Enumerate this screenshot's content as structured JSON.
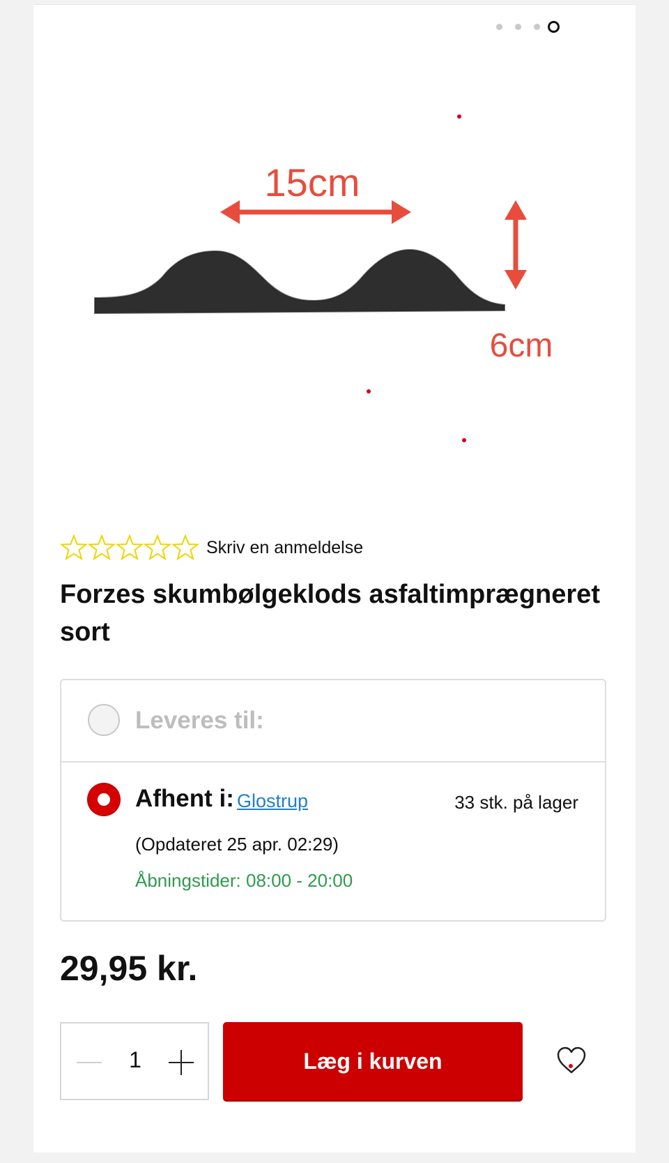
{
  "gallery": {
    "slide_count": 4,
    "active_slide": 4,
    "image": {
      "width_label": "15cm",
      "height_label": "6cm",
      "colors": {
        "foam": "#2e2e2e",
        "annotation": "#e84c3d"
      }
    }
  },
  "rating": {
    "stars_filled": 0,
    "stars_total": 5,
    "review_link": "Skriv en anmeldelse",
    "star_color": "#f0d400"
  },
  "product": {
    "title": "Forzes skumbølgeklods asfaltimprægneret sort",
    "price": "29,95 kr."
  },
  "delivery": {
    "delivery_option": {
      "label": "Leveres til:",
      "selected": false
    },
    "pickup_option": {
      "label": "Afhent i:",
      "store": "Glostrup",
      "stock": "33 stk. på lager",
      "updated": "(Opdateret 25 apr. 02:29)",
      "hours": "Åbningstider: 08:00 - 20:00",
      "selected": true
    }
  },
  "actions": {
    "quantity": "1",
    "add_to_cart": "Læg i kurven",
    "accent_color": "#cc0000",
    "wishlist_icon": "heart-icon"
  }
}
